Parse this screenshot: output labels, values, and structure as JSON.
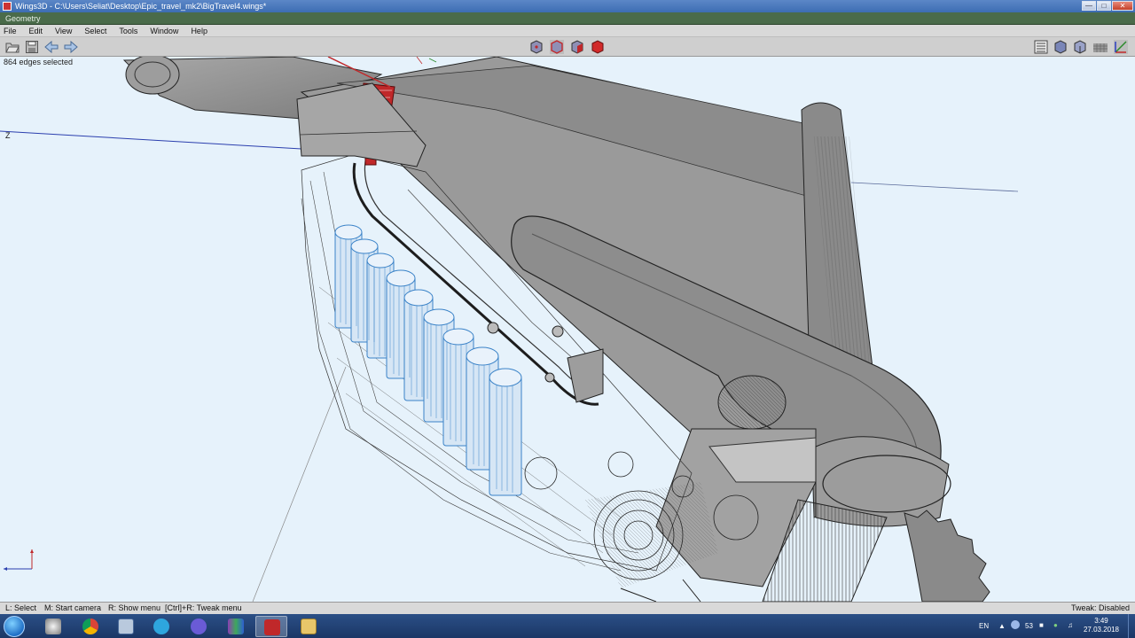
{
  "window": {
    "title": "Wings3D - C:\\Users\\Seliat\\Desktop\\Epic_travel_mk2\\BigTravel4.wings*",
    "buttons": [
      "minimize-button",
      "maximize-button",
      "close-button"
    ]
  },
  "geometry_bar": {
    "label": "Geometry"
  },
  "menu": {
    "items": [
      "File",
      "Edit",
      "View",
      "Select",
      "Tools",
      "Window",
      "Help"
    ]
  },
  "toolbar": {
    "left_icons": [
      "open-icon",
      "save-icon",
      "undo-icon",
      "redo-icon"
    ],
    "mode_icons": [
      "vertex-mode-icon",
      "edge-mode-icon",
      "face-mode-icon",
      "body-mode-icon"
    ],
    "right_icons": [
      "outliner-icon",
      "smooth-shading-icon",
      "flat-shading-icon",
      "grid-icon",
      "axes-icon"
    ]
  },
  "viewport": {
    "info": "864 edges selected",
    "axis_label": "Z",
    "colors": {
      "background": "#e6f2fb",
      "selection": "#c0282a",
      "batteries": "#3b83c8",
      "body": "#8f8f8f"
    }
  },
  "statusbar": {
    "hints": [
      "L: Select",
      "M: Start camera",
      "R: Show menu",
      "[Ctrl]+R: Tweak menu"
    ],
    "tweak": "Tweak: Disabled"
  },
  "taskbar": {
    "apps": [
      "chrome-icon",
      "calculator-icon",
      "telegram-icon",
      "browser-icon",
      "media-icon",
      "wings3d-icon",
      "explorer-icon"
    ],
    "language": "EN",
    "tray_count": "53",
    "time": "3:49",
    "date": "27.03.2018"
  }
}
